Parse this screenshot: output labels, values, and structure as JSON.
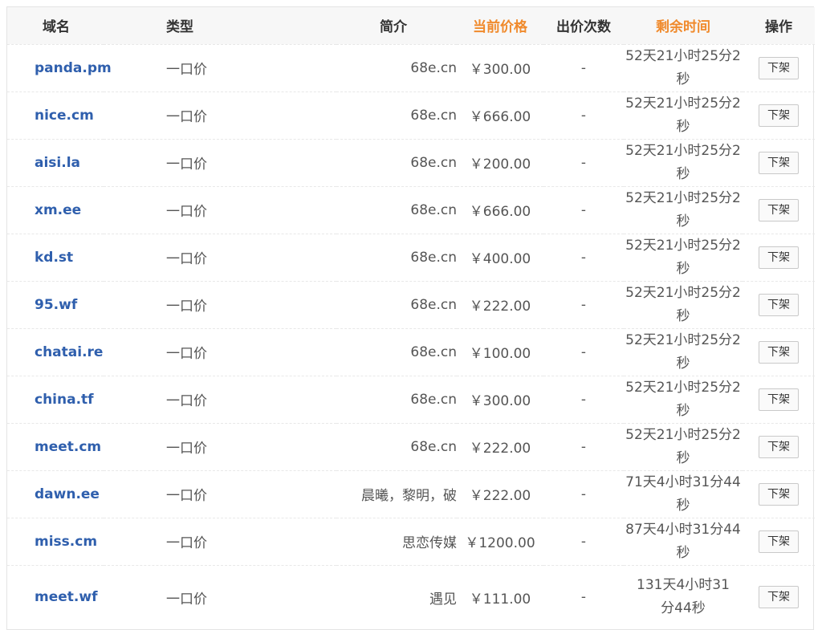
{
  "headers": {
    "domain": "域名",
    "type": "类型",
    "intro": "简介",
    "price": "当前价格",
    "bids": "出价次数",
    "remain": "剩余时间",
    "op": "操作"
  },
  "colors": {
    "highlight_header": "#f08a2c",
    "domain_link": "#2f5fad"
  },
  "rows": [
    {
      "domain": "panda.pm",
      "type": "一口价",
      "intro": "68e.cn",
      "price": "￥300.00",
      "bids": "-",
      "remain": "52天21小时25分2秒",
      "action": "下架"
    },
    {
      "domain": "nice.cm",
      "type": "一口价",
      "intro": "68e.cn",
      "price": "￥666.00",
      "bids": "-",
      "remain": "52天21小时25分2秒",
      "action": "下架"
    },
    {
      "domain": "aisi.la",
      "type": "一口价",
      "intro": "68e.cn",
      "price": "￥200.00",
      "bids": "-",
      "remain": "52天21小时25分2秒",
      "action": "下架"
    },
    {
      "domain": "xm.ee",
      "type": "一口价",
      "intro": "68e.cn",
      "price": "￥666.00",
      "bids": "-",
      "remain": "52天21小时25分2秒",
      "action": "下架"
    },
    {
      "domain": "kd.st",
      "type": "一口价",
      "intro": "68e.cn",
      "price": "￥400.00",
      "bids": "-",
      "remain": "52天21小时25分2秒",
      "action": "下架"
    },
    {
      "domain": "95.wf",
      "type": "一口价",
      "intro": "68e.cn",
      "price": "￥222.00",
      "bids": "-",
      "remain": "52天21小时25分2秒",
      "action": "下架"
    },
    {
      "domain": "chatai.re",
      "type": "一口价",
      "intro": "68e.cn",
      "price": "￥100.00",
      "bids": "-",
      "remain": "52天21小时25分2秒",
      "action": "下架"
    },
    {
      "domain": "china.tf",
      "type": "一口价",
      "intro": "68e.cn",
      "price": "￥300.00",
      "bids": "-",
      "remain": "52天21小时25分2秒",
      "action": "下架"
    },
    {
      "domain": "meet.cm",
      "type": "一口价",
      "intro": "68e.cn",
      "price": "￥222.00",
      "bids": "-",
      "remain": "52天21小时25分2秒",
      "action": "下架"
    },
    {
      "domain": "dawn.ee",
      "type": "一口价",
      "intro": "晨曦，黎明，破",
      "price": "￥222.00",
      "bids": "-",
      "remain": "71天4小时31分44秒",
      "action": "下架"
    },
    {
      "domain": "miss.cm",
      "type": "一口价",
      "intro": "思恋传媒",
      "price": "￥1200.00",
      "bids": "-",
      "remain": "87天4小时31分44秒",
      "action": "下架"
    },
    {
      "domain": "meet.wf",
      "type": "一口价",
      "intro": "遇见",
      "price": "￥111.00",
      "bids": "-",
      "remain": "131天4小时31分44秒",
      "action": "下架"
    }
  ]
}
